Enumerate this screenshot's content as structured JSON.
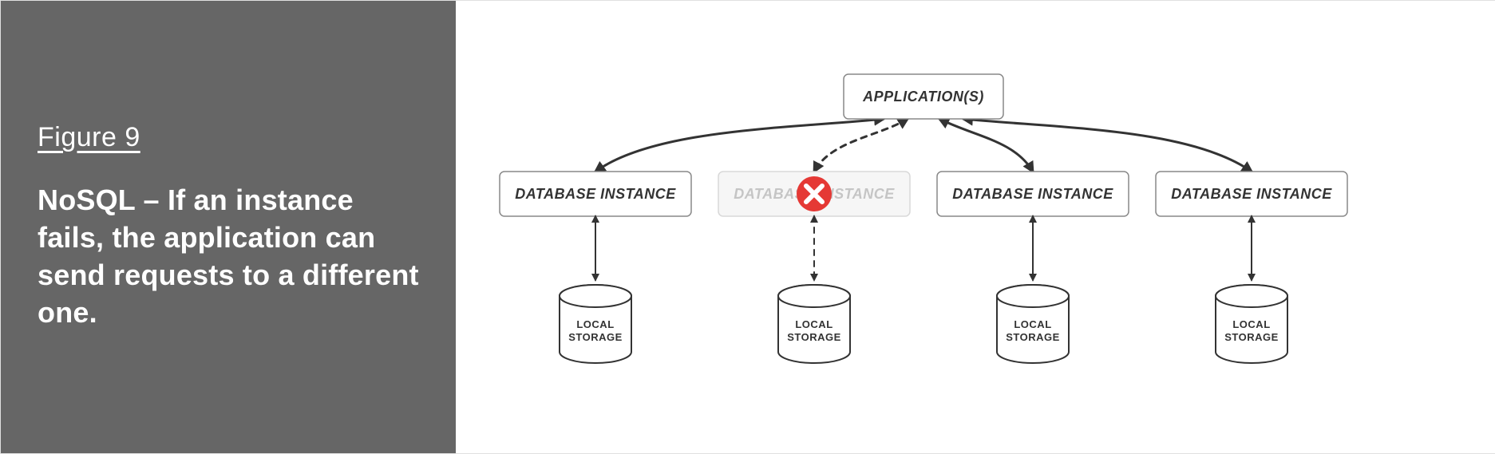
{
  "sidebar": {
    "figure_label": "Figure 9",
    "caption": "NoSQL – If an instance fails, the application can send requests to a different one."
  },
  "diagram": {
    "app_label": "APPLICATION(S)",
    "instances": [
      {
        "label": "DATABASE INSTANCE",
        "failed": false
      },
      {
        "label": "DATABASE INSTANCE",
        "failed": true
      },
      {
        "label": "DATABASE INSTANCE",
        "failed": false
      },
      {
        "label": "DATABASE INSTANCE",
        "failed": false
      }
    ],
    "storage_line1": "LOCAL",
    "storage_line2": "STORAGE",
    "fail_icon": "error-x-icon"
  }
}
